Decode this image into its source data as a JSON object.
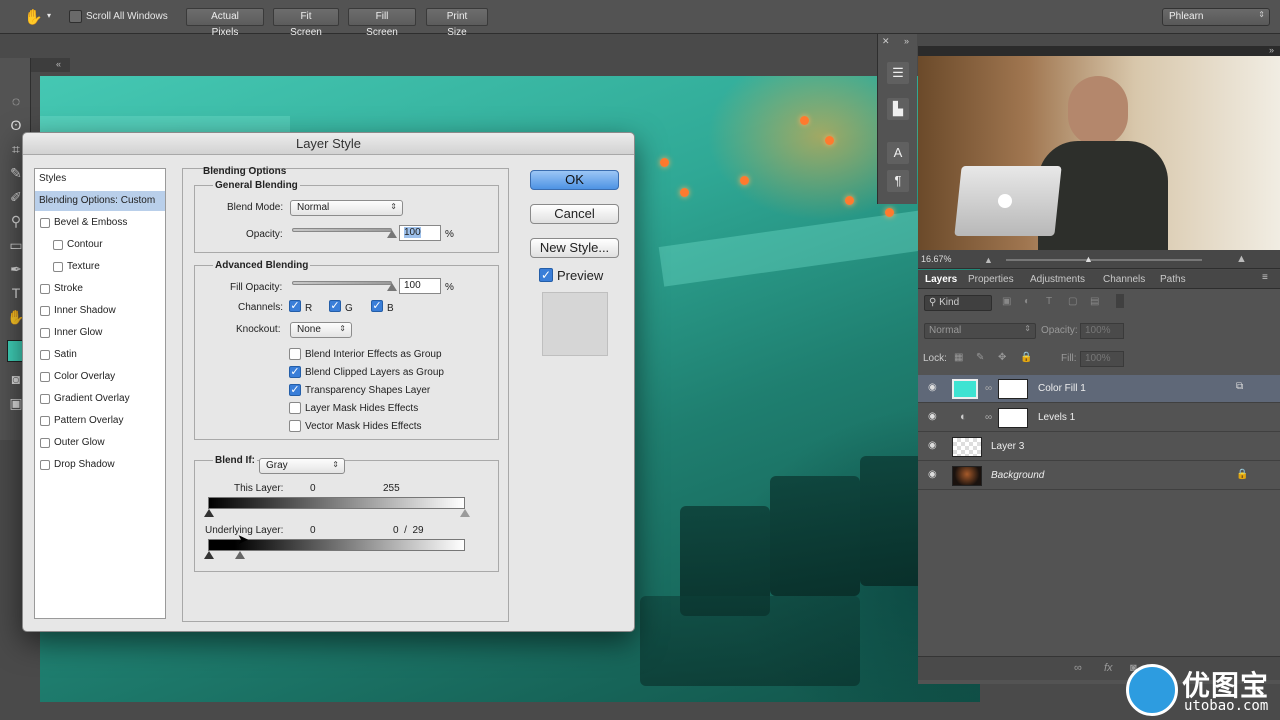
{
  "options_bar": {
    "scroll_all": "Scroll All Windows",
    "buttons": [
      "Actual Pixels",
      "Fit Screen",
      "Fill Screen",
      "Print Size"
    ],
    "workspace": "Phlearn"
  },
  "dialog": {
    "title": "Layer Style",
    "styles_header": "Styles",
    "styles": [
      {
        "label": "Blending Options: Custom",
        "checkbox": false,
        "indent": false,
        "active": true
      },
      {
        "label": "Bevel & Emboss",
        "checkbox": true,
        "indent": false
      },
      {
        "label": "Contour",
        "checkbox": true,
        "indent": true
      },
      {
        "label": "Texture",
        "checkbox": true,
        "indent": true
      },
      {
        "label": "Stroke",
        "checkbox": true,
        "indent": false
      },
      {
        "label": "Inner Shadow",
        "checkbox": true,
        "indent": false
      },
      {
        "label": "Inner Glow",
        "checkbox": true,
        "indent": false
      },
      {
        "label": "Satin",
        "checkbox": true,
        "indent": false
      },
      {
        "label": "Color Overlay",
        "checkbox": true,
        "indent": false
      },
      {
        "label": "Gradient Overlay",
        "checkbox": true,
        "indent": false
      },
      {
        "label": "Pattern Overlay",
        "checkbox": true,
        "indent": false
      },
      {
        "label": "Outer Glow",
        "checkbox": true,
        "indent": false
      },
      {
        "label": "Drop Shadow",
        "checkbox": true,
        "indent": false
      }
    ],
    "blending_options": "Blending Options",
    "general_blending": "General Blending",
    "blend_mode_label": "Blend Mode:",
    "blend_mode": "Normal",
    "opacity_label": "Opacity:",
    "opacity": "100",
    "opacity_fraction": 1.0,
    "pct": "%",
    "advanced_blending": "Advanced Blending",
    "fill_opacity_label": "Fill Opacity:",
    "fill_opacity": "100",
    "fill_opacity_fraction": 1.0,
    "channels_label": "Channels:",
    "channels": [
      "R",
      "G",
      "B"
    ],
    "knockout_label": "Knockout:",
    "knockout": "None",
    "options": [
      {
        "label": "Blend Interior Effects as Group",
        "checked": false
      },
      {
        "label": "Blend Clipped Layers as Group",
        "checked": true
      },
      {
        "label": "Transparency Shapes Layer",
        "checked": true
      },
      {
        "label": "Layer Mask Hides Effects",
        "checked": false
      },
      {
        "label": "Vector Mask Hides Effects",
        "checked": false
      }
    ],
    "blend_if_label": "Blend If:",
    "blend_if": "Gray",
    "this_layer_label": "This Layer:",
    "this_layer_low": "0",
    "this_layer_high": "255",
    "underlying_label": "Underlying Layer:",
    "underlying_low": "0",
    "underlying_split": "0  /  29",
    "buttons": {
      "ok": "OK",
      "cancel": "Cancel",
      "new_style": "New Style..."
    },
    "preview_label": "Preview"
  },
  "navigator": {
    "zoom": "16.67%"
  },
  "layers_panel": {
    "tabs": [
      "Layers",
      "Properties",
      "Adjustments",
      "Channels",
      "Paths"
    ],
    "kind": "Kind",
    "blend_mode": "Normal",
    "opacity_label": "Opacity:",
    "opacity": "100%",
    "lock_label": "Lock:",
    "fill_label": "Fill:",
    "fill": "100%",
    "layers": [
      {
        "name": "Color Fill 1",
        "selected": true
      },
      {
        "name": "Levels 1",
        "selected": false
      },
      {
        "name": "Layer 3",
        "selected": false
      },
      {
        "name": "Background",
        "selected": false
      }
    ]
  },
  "watermark": {
    "cn": "优图宝",
    "url": "utobao.com"
  }
}
